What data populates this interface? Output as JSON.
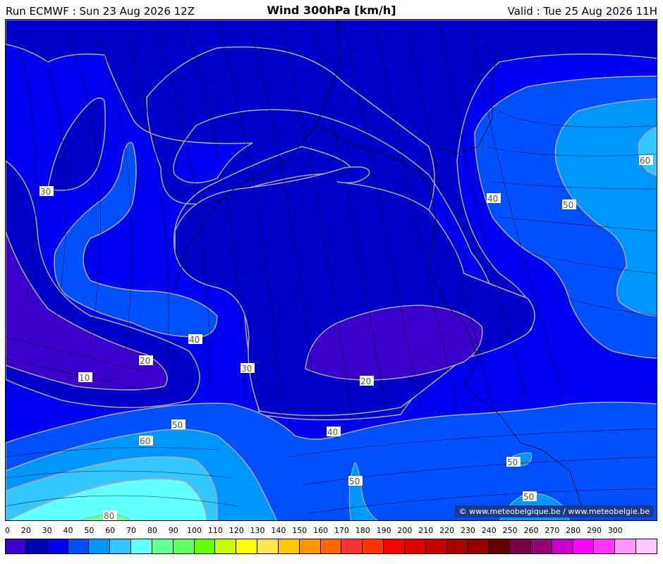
{
  "header": {
    "run": "Run ECMWF : Sun 23 Aug 2026 12Z",
    "title": "Wind 300hPa [km/h]",
    "valid": "Valid : Tue 25 Aug 2026 11H"
  },
  "map": {
    "contour_labels": [
      "30",
      "60",
      "40",
      "50",
      "40",
      "20",
      "30",
      "10",
      "20",
      "50",
      "60",
      "40",
      "50",
      "50",
      "50",
      "80"
    ],
    "credit": "© www.meteobelgique.be / www.meteobelgie.be"
  },
  "legend": {
    "ticks": [
      "0",
      "20",
      "30",
      "40",
      "50",
      "60",
      "70",
      "80",
      "90",
      "100",
      "110",
      "120",
      "130",
      "140",
      "150",
      "160",
      "170",
      "180",
      "190",
      "200",
      "210",
      "220",
      "230",
      "240",
      "250",
      "260",
      "270",
      "280",
      "290",
      "300"
    ],
    "colors": [
      "#3a00cc",
      "#0000b4",
      "#0000f0",
      "#0050ff",
      "#0096ff",
      "#32c8ff",
      "#64ffff",
      "#64ff96",
      "#64ff64",
      "#64ff00",
      "#c8ff00",
      "#ffff00",
      "#ffe650",
      "#ffc800",
      "#ff9600",
      "#ff6400",
      "#ff3232",
      "#ff3200",
      "#ff0000",
      "#e10000",
      "#c80000",
      "#aa0000",
      "#960000",
      "#640000",
      "#780046",
      "#960078",
      "#c800c8",
      "#ff00ff",
      "#ff32ff",
      "#ff96ff",
      "#ffc8ff"
    ]
  }
}
